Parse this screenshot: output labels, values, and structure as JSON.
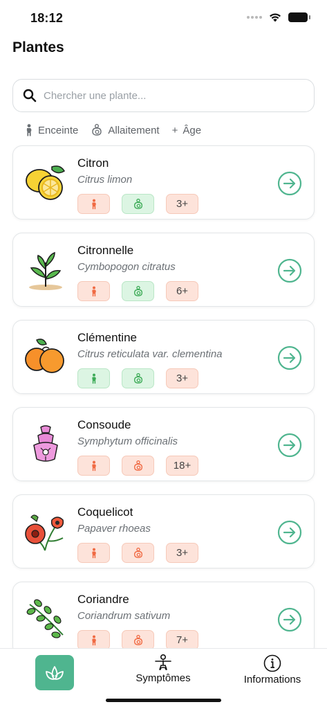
{
  "status": {
    "time": "18:12"
  },
  "header": {
    "title": "Plantes"
  },
  "search": {
    "placeholder": "Chercher une plante..."
  },
  "legend": {
    "pregnant": "Enceinte",
    "breastfeeding": "Allaitement",
    "age": "Âge",
    "age_prefix": "+"
  },
  "colors": {
    "accent": "#4fb58f",
    "unsafe": "#f06a43",
    "safe": "#3dab57"
  },
  "plants": [
    {
      "name": "Citron",
      "latin": "Citrus limon",
      "pregnancy": "unsafe",
      "breastfeeding": "safe",
      "age": "3+",
      "icon": "lemon-icon"
    },
    {
      "name": "Citronnelle",
      "latin": "Cymbopogon citratus",
      "pregnancy": "unsafe",
      "breastfeeding": "safe",
      "age": "6+",
      "icon": "sprout-icon"
    },
    {
      "name": "Clémentine",
      "latin": "Citrus reticulata var. clementina",
      "pregnancy": "safe",
      "breastfeeding": "safe",
      "age": "3+",
      "icon": "clementine-icon"
    },
    {
      "name": "Consoude",
      "latin": "Symphytum officinalis",
      "pregnancy": "unsafe",
      "breastfeeding": "unsafe",
      "age": "18+",
      "icon": "foxglove-flower-icon"
    },
    {
      "name": "Coquelicot",
      "latin": "Papaver rhoeas",
      "pregnancy": "unsafe",
      "breastfeeding": "unsafe",
      "age": "3+",
      "icon": "poppy-icon"
    },
    {
      "name": "Coriandre",
      "latin": "Coriandrum sativum",
      "pregnancy": "unsafe",
      "breastfeeding": "unsafe",
      "age": "7+",
      "icon": "herb-branch-icon"
    }
  ],
  "tabs": {
    "plants": "plants-tab",
    "symptoms": "Symptômes",
    "info": "Informations"
  }
}
